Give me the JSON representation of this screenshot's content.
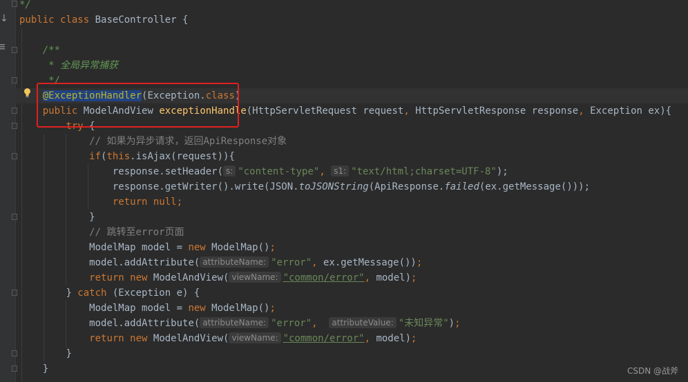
{
  "code": {
    "l_close_comment": "*/",
    "l_class": {
      "kw_public": "public",
      "kw_class": "class",
      "name": " BaseController {"
    },
    "l_jd_open": "/**",
    "l_jd_text": " * 全局异常捕获",
    "l_jd_close": " */",
    "l_annotation": {
      "name": "@ExceptionHandler",
      "rest": "(Exception.",
      "kw": "class",
      "close": ")"
    },
    "l_signature": {
      "kw": "public",
      "type": " ModelAndView ",
      "fn": "exceptionHandle",
      "params_a": "(HttpServletRequest request",
      "comma1": ",",
      "params_b": " HttpServletResponse response",
      "comma2": ",",
      "params_c": " Exception ex){"
    },
    "l_try": {
      "kw": "try",
      "rest": " {"
    },
    "l_comment1": "// 如果为异步请求，返回ApiResponse对象",
    "l_if": {
      "kw": "if",
      "open": "(",
      "kw_this": "this",
      "rest": ".isAjax(request)){"
    },
    "l_setheader": {
      "pre": "response.setHeader(",
      "hint1": "s:",
      "str1": "\"content-type\"",
      "comma": ",",
      "hint2": "s1:",
      "str2": "\"text/html;charset=UTF-8\"",
      "end": ");"
    },
    "l_write": {
      "pre": "response.getWriter().write(JSON.",
      "it1": "toJSONString",
      "mid": "(ApiResponse.",
      "it2": "failed",
      "end": "(ex.getMessage()));"
    },
    "l_return_null": {
      "kw1": "return",
      "kw2": "null",
      "end": ";"
    },
    "l_brace1": "}",
    "l_comment2": "// 跳转至error页面",
    "l_modelmap1": {
      "pre": "ModelMap model = ",
      "kw": "new",
      "post": " ModelMap()",
      "end": ";"
    },
    "l_addattr1": {
      "pre": "model.addAttribute(",
      "hint": "attributeName:",
      "str": "\"error\"",
      "comma": ",",
      "post": " ex.getMessage())",
      "end": ";"
    },
    "l_return_mav1": {
      "kw1": "return",
      "kw2": "new",
      "type": " ModelAndView(",
      "hint": "viewName:",
      "str": "\"common/error\"",
      "comma": ",",
      "post": " model)",
      "end": ";"
    },
    "l_catch": {
      "pre": "} ",
      "kw": "catch",
      "post": " (Exception e) {"
    },
    "l_modelmap2": {
      "pre": "ModelMap model = ",
      "kw": "new",
      "post": " ModelMap()",
      "end": ";"
    },
    "l_addattr2": {
      "pre": "model.addAttribute(",
      "hint1": "attributeName:",
      "str1": "\"error\"",
      "comma": ",",
      "hint2": "attributeValue:",
      "str2": "\"未知异常\"",
      "post": ")",
      "end": ";"
    },
    "l_return_mav2": {
      "kw1": "return",
      "kw2": "new",
      "type": " ModelAndView(",
      "hint": "viewName:",
      "str": "\"common/error\"",
      "comma": ",",
      "post": " model)",
      "end": ";"
    },
    "l_brace2": "}",
    "l_brace3": "}"
  },
  "watermark": "CSDN @战斧",
  "colors": {
    "highlight_box": "#e02020",
    "keyword": "#cc7832",
    "string": "#6a8759",
    "method": "#ffc66d"
  }
}
